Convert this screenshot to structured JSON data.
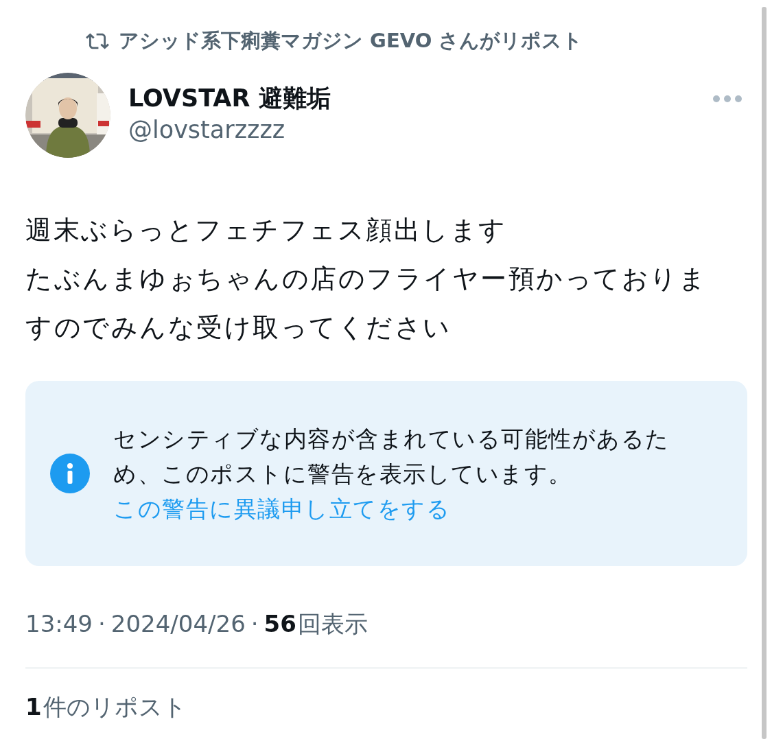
{
  "repost_banner": {
    "text": "アシッド系下痢糞マガジン GEVO さんがリポスト"
  },
  "author": {
    "name": "LOVSTAR 避難垢",
    "handle": "@lovstarzzzz"
  },
  "body": {
    "lines": [
      "週末ぶらっとフェチフェス顔出します",
      "たぶんまゆぉちゃんの店のフライヤー預かっておりますのでみんな受け取ってください"
    ]
  },
  "warning": {
    "text": "センシティブな内容が含まれている可能性があるため、このポストに警告を表示しています。",
    "link": "この警告に異議申し立てをする"
  },
  "meta": {
    "time": "13:49",
    "separator_1": "·",
    "date": "2024/04/26",
    "separator_2": "·",
    "views_count": "56",
    "views_label": "回表示"
  },
  "reposts": {
    "count": "1",
    "label": "件のリポスト"
  }
}
